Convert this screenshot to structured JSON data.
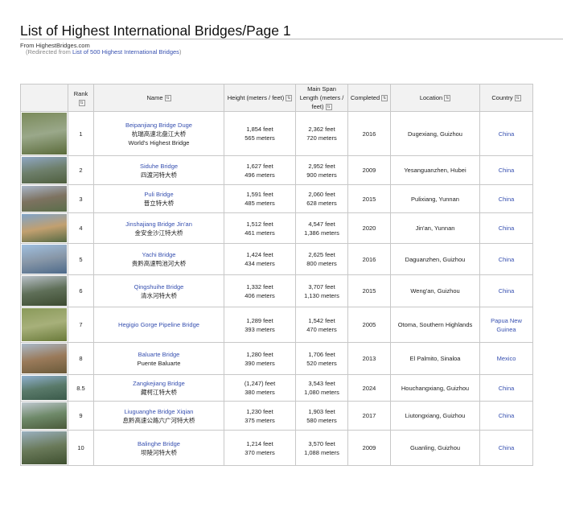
{
  "page": {
    "title": "List of Highest International Bridges/Page 1",
    "from": "From HighestBridges.com",
    "redirect_prefix": "(Redirected from ",
    "redirect_link": "List of 500 Highest International Bridges",
    "redirect_suffix": ")"
  },
  "table": {
    "headers": [
      "",
      "Rank",
      "Name",
      "Height (meters / feet)",
      "Main Span Length (meters / feet)",
      "Completed",
      "Location",
      "Country"
    ],
    "rows": [
      {
        "rank": "1",
        "name": "Beipanjiang Bridge Duge",
        "sub": [
          "杭瑞高速北盘江大桥",
          "World's Highest Bridge"
        ],
        "h_ft": "1,854 feet",
        "h_m": "565 meters",
        "s_ft": "2,362 feet",
        "s_m": "720 meters",
        "year": "2016",
        "location": "Dugexiang, Guizhou",
        "country": "China"
      },
      {
        "rank": "2",
        "name": "Siduhe Bridge",
        "sub": [
          "四渡河特大桥"
        ],
        "h_ft": "1,627 feet",
        "h_m": "496 meters",
        "s_ft": "2,952 feet",
        "s_m": "900 meters",
        "year": "2009",
        "location": "Yesanguanzhen, Hubei",
        "country": "China"
      },
      {
        "rank": "3",
        "name": "Puli Bridge",
        "sub": [
          "普立特大桥"
        ],
        "h_ft": "1,591 feet",
        "h_m": "485 meters",
        "s_ft": "2,060 feet",
        "s_m": "628 meters",
        "year": "2015",
        "location": "Pulixiang, Yunnan",
        "country": "China"
      },
      {
        "rank": "4",
        "name": "Jinshajiang Bridge Jin'an",
        "sub": [
          "金安金沙江特大桥"
        ],
        "h_ft": "1,512 feet",
        "h_m": "461 meters",
        "s_ft": "4,547 feet",
        "s_m": "1,386 meters",
        "year": "2020",
        "location": "Jin'an, Yunnan",
        "country": "China"
      },
      {
        "rank": "5",
        "name": "Yachi Bridge",
        "sub": [
          "贵黔高速鸭池河大桥"
        ],
        "h_ft": "1,424 feet",
        "h_m": "434 meters",
        "s_ft": "2,625 feet",
        "s_m": "800 meters",
        "year": "2016",
        "location": "Daguanzhen, Guizhou",
        "country": "China"
      },
      {
        "rank": "6",
        "name": "Qingshuihe Bridge",
        "sub": [
          "清水河特大桥"
        ],
        "h_ft": "1,332 feet",
        "h_m": "406 meters",
        "s_ft": "3,707 feet",
        "s_m": "1,130 meters",
        "year": "2015",
        "location": "Weng'an, Guizhou",
        "country": "China"
      },
      {
        "rank": "7",
        "name": "Hegigio Gorge Pipeline Bridge",
        "sub": [],
        "h_ft": "1,289 feet",
        "h_m": "393 meters",
        "s_ft": "1,542 feet",
        "s_m": "470 meters",
        "year": "2005",
        "location": "Otoma, Southern Highlands",
        "country": "Papua New Guinea"
      },
      {
        "rank": "8",
        "name": "Baluarte Bridge",
        "sub": [
          "Puente Baluarte"
        ],
        "h_ft": "1,280 feet",
        "h_m": "390 meters",
        "s_ft": "1,706 feet",
        "s_m": "520 meters",
        "year": "2013",
        "location": "El Palmito, Sinaloa",
        "country": "Mexico"
      },
      {
        "rank": "8.5",
        "name": "Zangkejiang Bridge",
        "sub": [
          "藏柯江特大桥"
        ],
        "h_ft": "(1,247) feet",
        "h_m": "380 meters",
        "s_ft": "3,543 feet",
        "s_m": "1,080 meters",
        "year": "2024",
        "location": "Houchangxiang, Guizhou",
        "country": "China"
      },
      {
        "rank": "9",
        "name": "Liuguanghe Bridge Xiqian",
        "sub": [
          "息黔高速公路六广河特大桥"
        ],
        "h_ft": "1,230 feet",
        "h_m": "375 meters",
        "s_ft": "1,903 feet",
        "s_m": "580 meters",
        "year": "2017",
        "location": "Liutongxiang, Guizhou",
        "country": "China"
      },
      {
        "rank": "10",
        "name": "Balinghe Bridge",
        "sub": [
          "坝陵河特大桥"
        ],
        "h_ft": "1,214 feet",
        "h_m": "370 meters",
        "s_ft": "3,570 feet",
        "s_m": "1,088 meters",
        "year": "2009",
        "location": "Guanling, Guizhou",
        "country": "China"
      }
    ]
  },
  "colors": {
    "link": "#3750b0",
    "header_bg": "#f2f2f2",
    "border": "#c8c8c8"
  }
}
